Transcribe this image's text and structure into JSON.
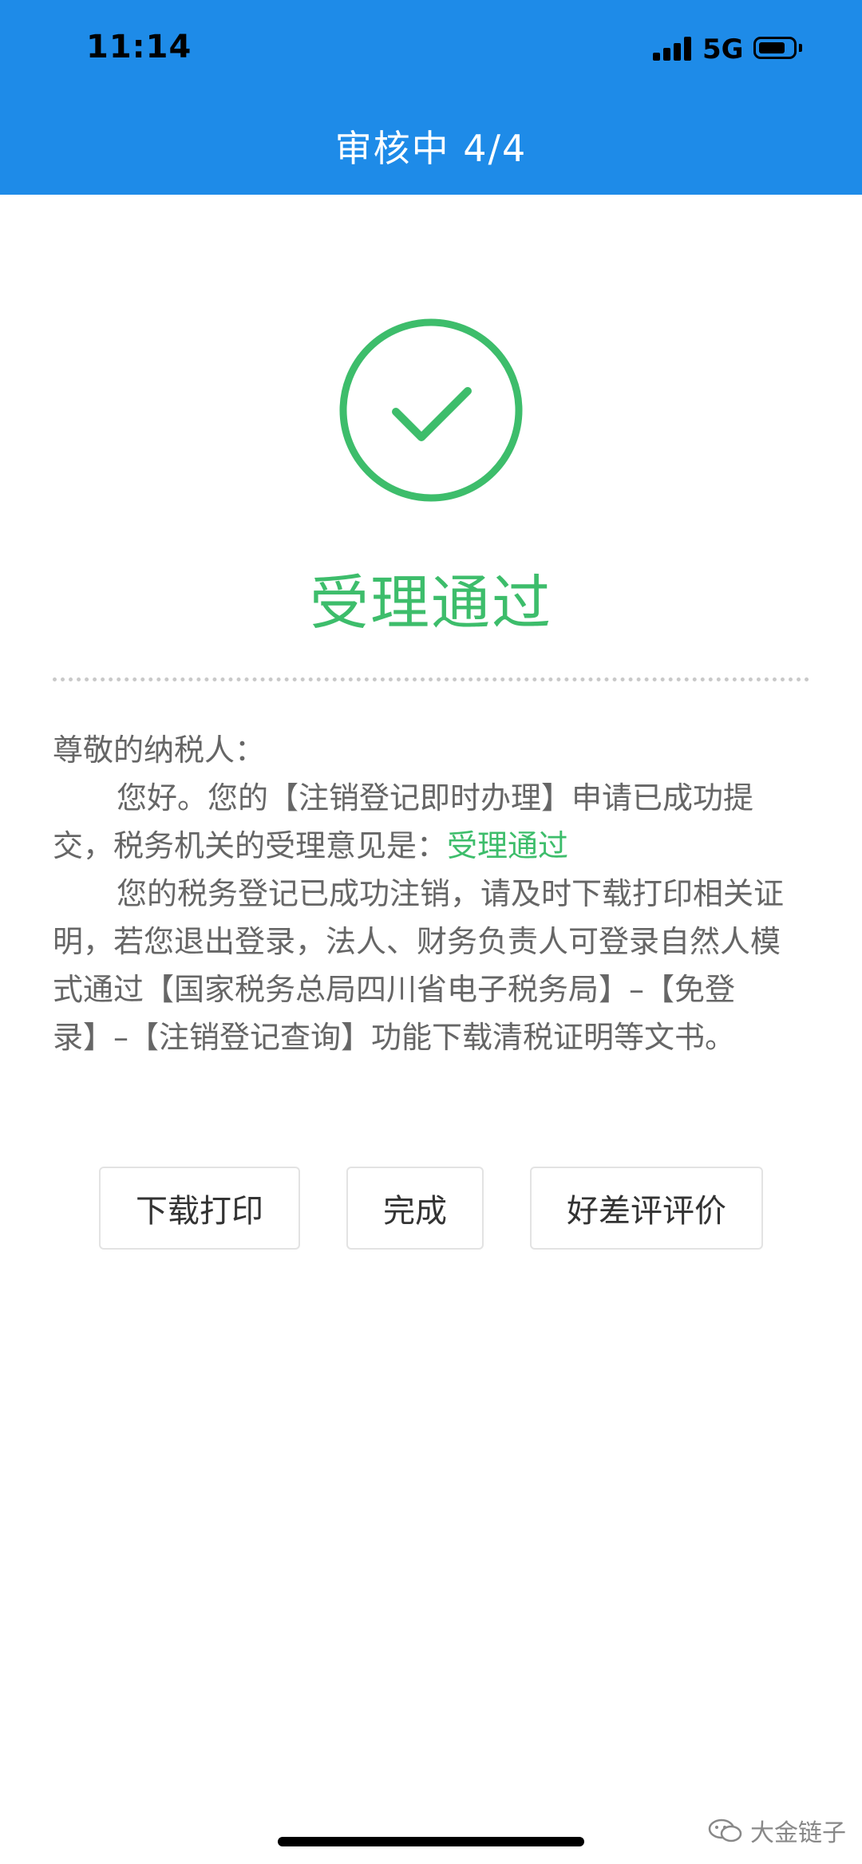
{
  "status_bar": {
    "time": "11:14",
    "network": "5G"
  },
  "header": {
    "title": "审核中 4/4",
    "background": "#1e8be8"
  },
  "result": {
    "icon": "check-circle-icon",
    "title": "受理通过",
    "color": "#3dbd6b"
  },
  "message": {
    "salutation": "尊敬的纳税人：",
    "p1_before": "您好。您的【注销登记即时办理】申请已成功提交，税务机关的受理意见是：",
    "p1_highlight": "受理通过",
    "p2": "您的税务登记已成功注销，请及时下载打印相关证明，若您退出登录，法人、财务负责人可登录自然人模式通过【国家税务总局四川省电子税务局】–【免登录】–【注销登记查询】功能下载清税证明等文书。"
  },
  "actions": {
    "download_label": "下载打印",
    "done_label": "完成",
    "rate_label": "好差评评价"
  },
  "watermark": {
    "text": "大金链子"
  }
}
